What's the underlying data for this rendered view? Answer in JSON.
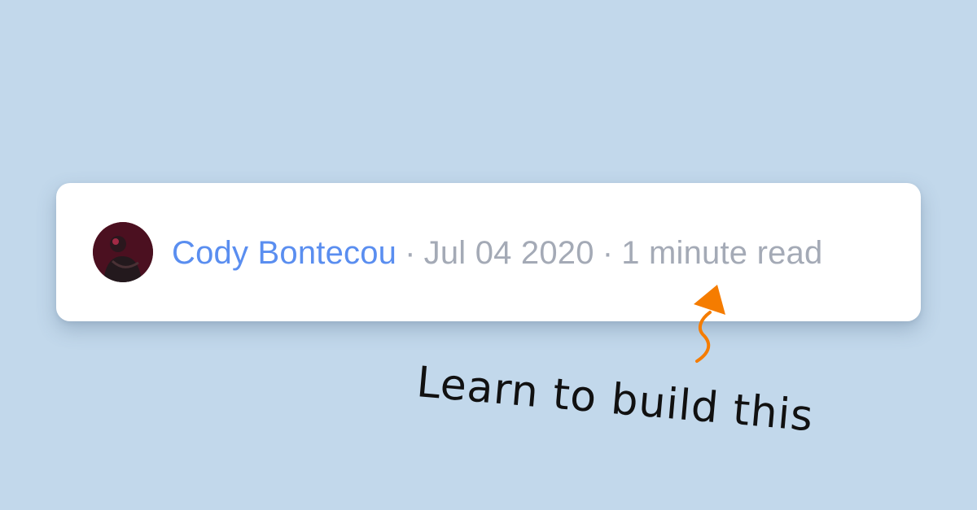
{
  "byline": {
    "author": "Cody Bontecou",
    "separator": "·",
    "date": "Jul 04 2020",
    "read_time": "1 minute read"
  },
  "annotation": {
    "text": "Learn to build this",
    "arrow_color": "#f57c00"
  },
  "colors": {
    "background": "#c2d8eb",
    "card": "#ffffff",
    "author_link": "#5a8ef0",
    "meta_text": "#a4aab6"
  },
  "icons": {
    "avatar": "author-avatar",
    "arrow": "up-arrow-icon"
  }
}
